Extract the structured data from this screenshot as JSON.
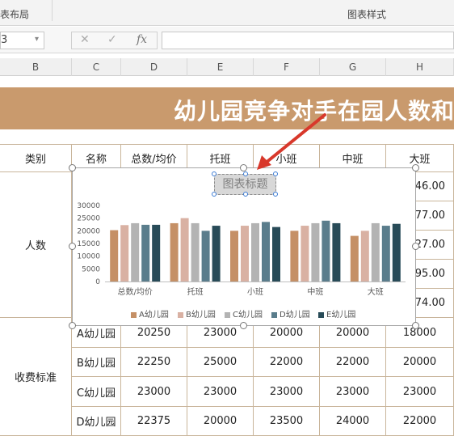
{
  "ribbon": {
    "group_left": "表布局",
    "group_right": "图表样式"
  },
  "formula_bar": {
    "name_box": "3",
    "icon_cancel": "✕",
    "icon_enter": "✓",
    "icon_fx": "fx"
  },
  "columns": [
    "B",
    "C",
    "D",
    "E",
    "F",
    "G",
    "H"
  ],
  "banner_title": "幼儿园竞争对手在园人数和",
  "header_row": [
    "类别",
    "名称",
    "总数/均价",
    "托班",
    "小班",
    "中班",
    "大班"
  ],
  "row_groups": {
    "people": "人数",
    "fees": "收费标准"
  },
  "people_h_values": [
    "46.00",
    "77.00",
    "27.00",
    "95.00",
    "74.00"
  ],
  "fee_rows": [
    {
      "name": "A幼儿园",
      "total": "20250",
      "tuo": "23000",
      "xiao": "20000",
      "zhong": "20000",
      "da": "18000"
    },
    {
      "name": "B幼儿园",
      "total": "22250",
      "tuo": "25000",
      "xiao": "22000",
      "zhong": "22000",
      "da": "20000"
    },
    {
      "name": "C幼儿园",
      "total": "23000",
      "tuo": "23000",
      "xiao": "23000",
      "zhong": "23000",
      "da": "23000"
    },
    {
      "name": "D幼儿园",
      "total": "22375",
      "tuo": "20000",
      "xiao": "23500",
      "zhong": "24000",
      "da": "22000"
    }
  ],
  "chart_data": {
    "type": "bar",
    "title": "图表标题",
    "categories": [
      "总数/均价",
      "托班",
      "小班",
      "中班",
      "大班"
    ],
    "series": [
      {
        "name": "A幼儿园",
        "values": [
          20250,
          23000,
          20000,
          20000,
          18000
        ]
      },
      {
        "name": "B幼儿园",
        "values": [
          22250,
          25000,
          22000,
          22000,
          20000
        ]
      },
      {
        "name": "C幼儿园",
        "values": [
          23000,
          23000,
          23000,
          23000,
          23000
        ]
      },
      {
        "name": "D幼儿园",
        "values": [
          22375,
          20000,
          23500,
          24000,
          22000
        ]
      },
      {
        "name": "E幼儿园",
        "values": [
          22375,
          22000,
          21500,
          23000,
          22750
        ]
      }
    ],
    "colors": [
      "#c59066",
      "#d9b1a3",
      "#b3b3b3",
      "#5a7d8c",
      "#284b58"
    ],
    "ylim": [
      0,
      30000
    ],
    "yticks": [
      0,
      5000,
      10000,
      15000,
      20000,
      25000,
      30000
    ],
    "legend_position": "bottom",
    "grid": false
  },
  "annotation": {
    "arrow_color": "#d8382b"
  }
}
